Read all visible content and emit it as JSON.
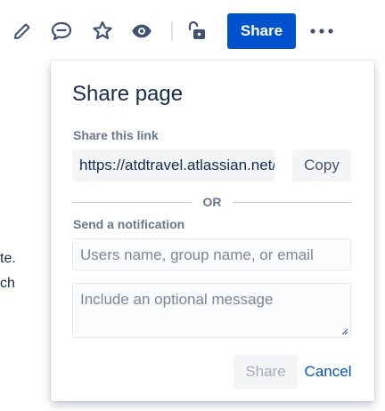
{
  "toolbar": {
    "icons": [
      "edit-icon",
      "comment-icon",
      "star-icon",
      "watch-icon",
      "restrictions-unlocked-icon",
      "more-icon"
    ],
    "share_label": "Share"
  },
  "background_text": {
    "line1": "te.",
    "line2": "ch"
  },
  "dialog": {
    "title": "Share page",
    "link_label": "Share this link",
    "link_value": "https://atdtravel.atlassian.net/wiki/spaces/",
    "copy_label": "Copy",
    "or_label": "OR",
    "notify_label": "Send a notification",
    "users_placeholder": "Users name, group name, or email",
    "message_placeholder": "Include an optional message",
    "share_label": "Share",
    "cancel_label": "Cancel"
  },
  "colors": {
    "primary": "#0052cc",
    "text": "#172b4d",
    "subtle_text": "#6b778c",
    "field_bg": "#f4f5f7",
    "icon": "#42526e"
  }
}
